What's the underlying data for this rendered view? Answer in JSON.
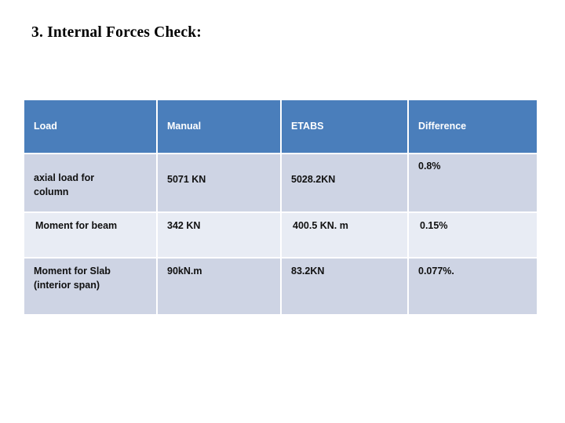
{
  "slide": {
    "title": "3. Internal Forces Check:",
    "background_color": "#ffffff"
  },
  "table": {
    "header_background": "#4a7ebb",
    "header_text_color": "#ffffff",
    "row_dark_background": "#ced4e4",
    "row_light_background": "#e8ecf4",
    "columns": [
      {
        "key": "load",
        "label": "Load"
      },
      {
        "key": "manual",
        "label": "Manual"
      },
      {
        "key": "etabs",
        "label": "ETABS"
      },
      {
        "key": "difference",
        "label": "Difference"
      }
    ],
    "rows": [
      {
        "load": "axial load for\ncolumn",
        "manual": "5071 KN",
        "etabs": "5028.2KN",
        "difference": "0.8%"
      },
      {
        "load": " Moment for beam",
        "manual": "342  KN",
        "etabs": "400.5 KN. m",
        "difference": "0.15%"
      },
      {
        "load": "Moment for Slab\n(interior span)",
        "manual": "90kN.m",
        "etabs": "83.2KN",
        "difference": "0.077%."
      }
    ]
  }
}
